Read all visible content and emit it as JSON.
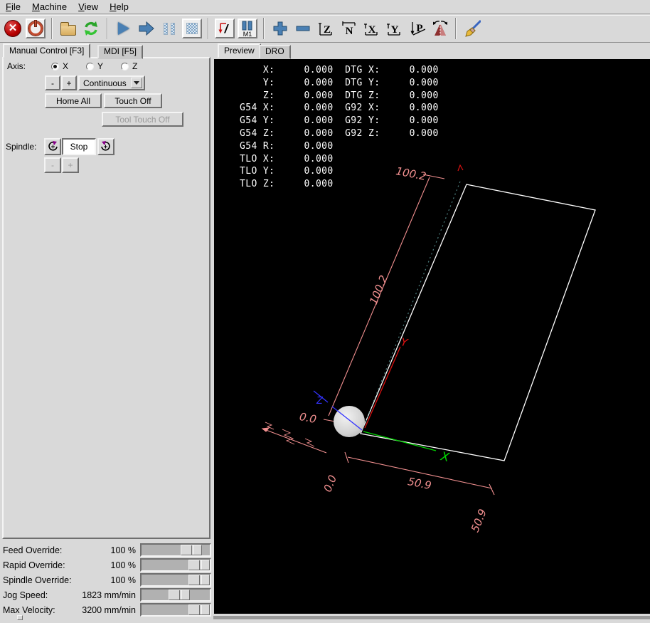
{
  "menu": {
    "items": [
      {
        "label": "File"
      },
      {
        "label": "Machine"
      },
      {
        "label": "View"
      },
      {
        "label": "Help"
      }
    ]
  },
  "toolbar": {
    "buttons": [
      "estop-icon",
      "machine-power-icon",
      "open-file-icon",
      "reload-icon",
      "run-icon",
      "step-icon",
      "pause-icon",
      "stop-icon",
      "skip-lines-icon",
      "optional-pause-icon",
      "zoom-in-icon",
      "zoom-out-icon",
      "view-z-icon",
      "view-z-rotated-icon",
      "view-x-icon",
      "view-y-icon",
      "view-perspective-icon",
      "rotate-icon",
      "clear-plot-icon"
    ],
    "skip_label": "/",
    "m1_label": "M1",
    "views": {
      "z": "Z",
      "z_rotated": "N",
      "x": "X",
      "y": "Y",
      "p": "P"
    }
  },
  "left_panel": {
    "tabs": [
      {
        "label": "Manual Control [F3]"
      },
      {
        "label": "MDI [F5]"
      }
    ],
    "axis": {
      "label": "Axis:",
      "options": [
        {
          "label": "X",
          "selected": true
        },
        {
          "label": "Y",
          "selected": false
        },
        {
          "label": "Z",
          "selected": false
        }
      ]
    },
    "jog": {
      "minus": "-",
      "plus": "+",
      "mode": "Continuous"
    },
    "buttons": {
      "home_all": "Home All",
      "touch_off": "Touch Off",
      "tool_touch_off": "Tool Touch Off"
    },
    "spindle": {
      "label": "Spindle:",
      "stop": "Stop",
      "minus": "-",
      "plus": "+"
    },
    "sliders": [
      {
        "label": "Feed Override:",
        "value": "100 %",
        "handle_pct": 83
      },
      {
        "label": "Rapid Override:",
        "value": "100 %",
        "handle_pct": 100
      },
      {
        "label": "Spindle Override:",
        "value": "100 %",
        "handle_pct": 100
      },
      {
        "label": "Jog Speed:",
        "value": "1823 mm/min",
        "handle_pct": 57
      },
      {
        "label": "Max Velocity:",
        "value": "3200 mm/min",
        "handle_pct": 100
      }
    ]
  },
  "preview": {
    "tabs": [
      {
        "label": "Preview"
      },
      {
        "label": "DRO"
      }
    ],
    "dro_lines": [
      "    X:     0.000  DTG X:     0.000",
      "    Y:     0.000  DTG Y:     0.000",
      "    Z:     0.000  DTG Z:     0.000",
      "G54 X:     0.000  G92 X:     0.000",
      "G54 Y:     0.000  G92 Y:     0.000",
      "G54 Z:     0.000  G92 Z:     0.000",
      "G54 R:     0.000",
      "TLO X:     0.000",
      "TLO Y:     0.000",
      "TLO Z:     0.000"
    ],
    "dims": {
      "y_top": "100.2",
      "y_mid": "100.2",
      "y_zero": "0.0",
      "x_mid": "50.9",
      "x_zero": "0.0",
      "x_end": "50.9"
    },
    "axis_letters": {
      "x": "X",
      "y": "Y",
      "z": "Z"
    },
    "colors": {
      "dimension": "#f29090",
      "rapid_path": "#4d7f7f",
      "feed_path": "#ffffff",
      "axis_x": "#00d400",
      "axis_y": "#dd1111",
      "axis_z": "#3333ff",
      "tool": "#d9d9d9"
    }
  }
}
